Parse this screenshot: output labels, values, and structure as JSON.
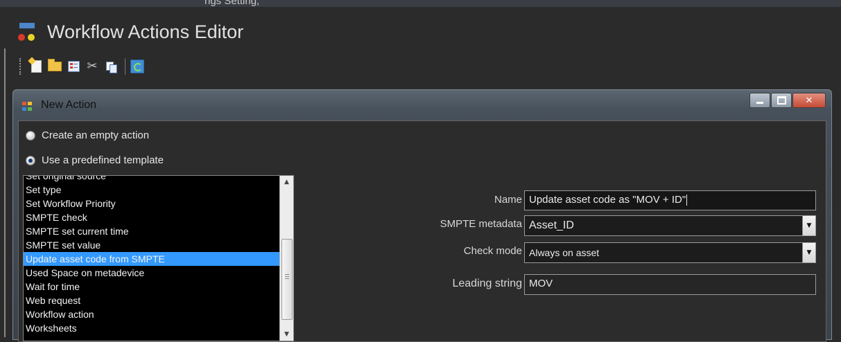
{
  "top_strip_text": "ngs Setting,",
  "app": {
    "title": "Workflow Actions Editor",
    "logo_icon": "workflow-icon"
  },
  "toolbar": {
    "buttons": [
      {
        "icon": "new-icon"
      },
      {
        "icon": "open-folder-icon"
      },
      {
        "icon": "properties-icon"
      },
      {
        "icon": "cut-icon"
      },
      {
        "icon": "copy-icon"
      },
      {
        "icon": "refresh-icon"
      }
    ]
  },
  "dialog": {
    "title": "New Action",
    "options": {
      "empty": "Create an empty action",
      "template": "Use a predefined template",
      "selected": "template"
    },
    "templates": [
      "Set original source",
      "Set type",
      "Set Workflow Priority",
      "SMPTE check",
      "SMPTE set current time",
      "SMPTE set value",
      "Update asset code from SMPTE",
      "Used Space on metadevice",
      "Wait for time",
      "Web request",
      "Workflow action",
      "Worksheets"
    ],
    "selected_template": "Update asset code from SMPTE",
    "form": {
      "name_label": "Name",
      "name_value": "Update asset code as \"MOV + ID\"",
      "smpte_label": "SMPTE metadata",
      "smpte_value": "Asset_ID",
      "check_label": "Check mode",
      "check_value": "Always on asset",
      "leading_label": "Leading string",
      "leading_value": "MOV"
    }
  },
  "colors": {
    "selection": "#3399ff",
    "background": "#2b2b2b",
    "list_background": "#000000"
  }
}
